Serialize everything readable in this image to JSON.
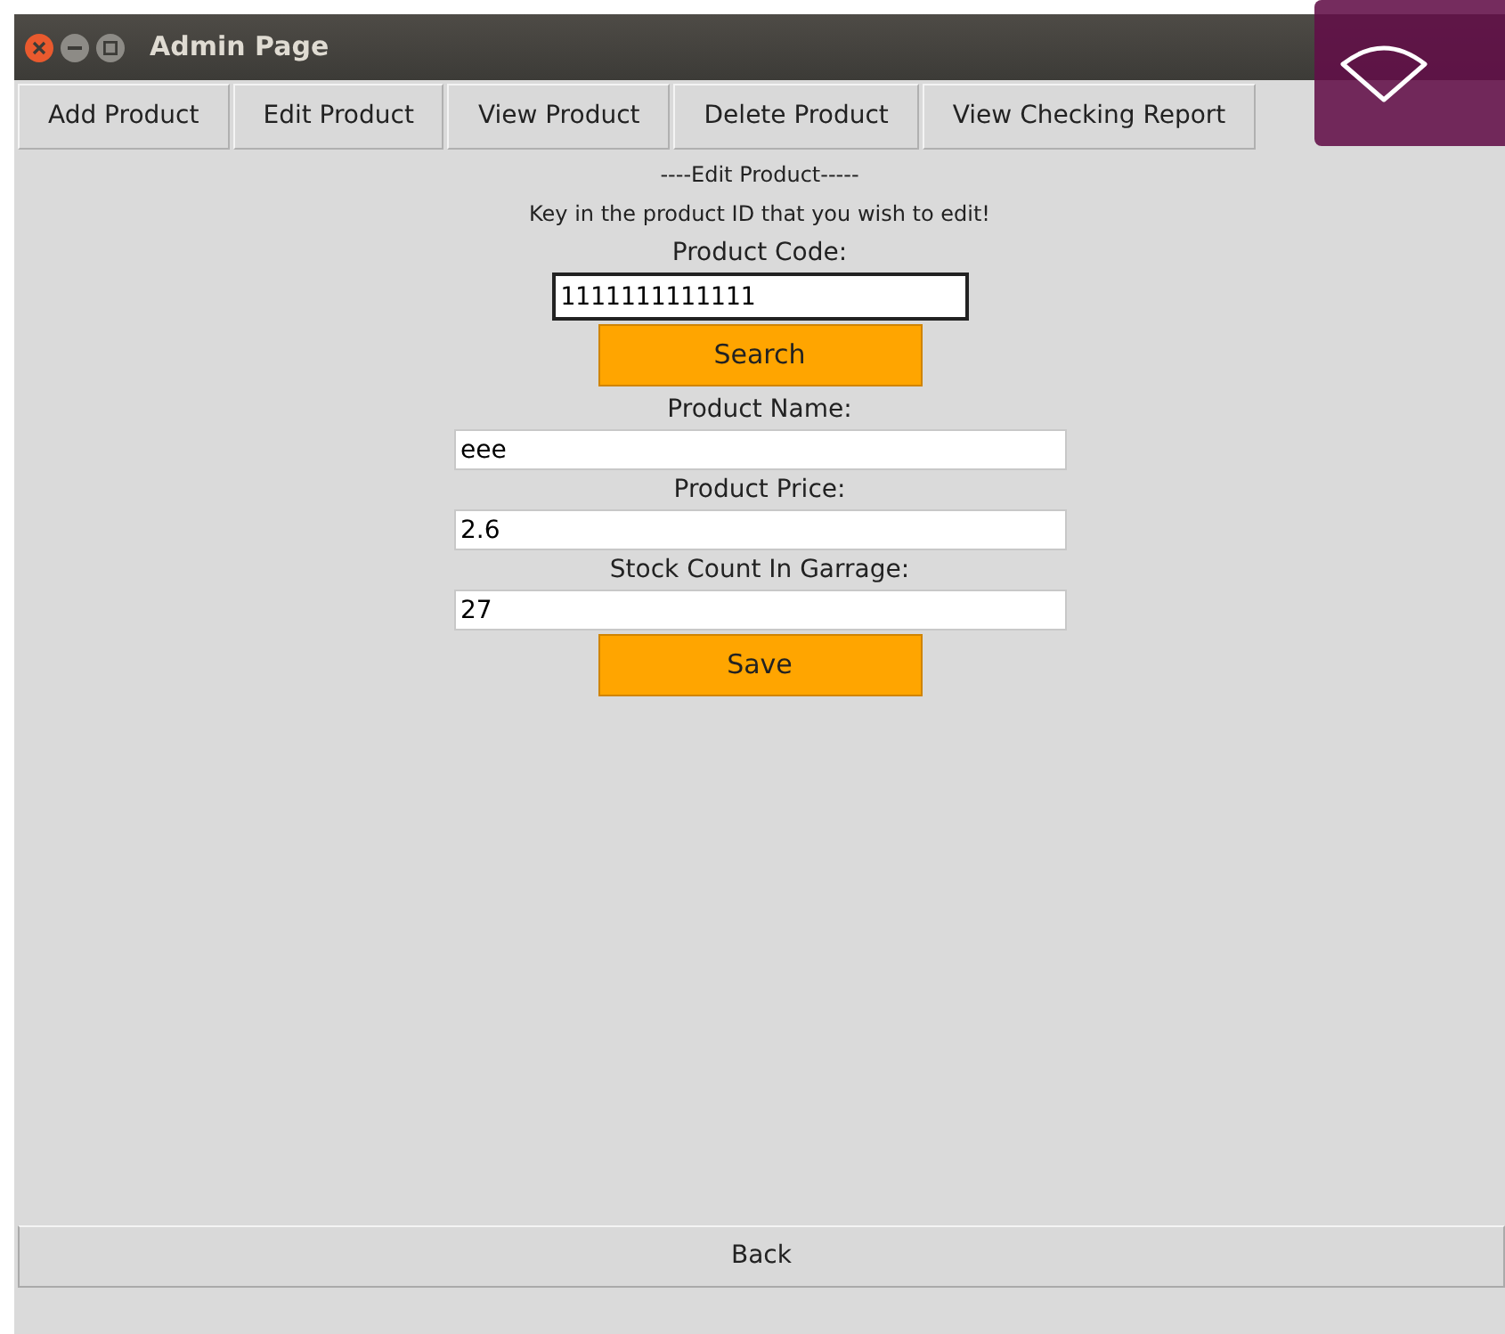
{
  "window": {
    "title": "Admin Page"
  },
  "tabs": [
    {
      "label": "Add Product"
    },
    {
      "label": "Edit Product"
    },
    {
      "label": "View Product"
    },
    {
      "label": "Delete Product"
    },
    {
      "label": "View Checking Report"
    }
  ],
  "form": {
    "heading": "----Edit Product-----",
    "instruction": "Key in the product ID that you wish to edit!",
    "fields": [
      {
        "kind": "code",
        "label": "Product Code:",
        "value": "1111111111111",
        "focused": true
      },
      {
        "kind": "button",
        "label": "Search"
      },
      {
        "kind": "text",
        "label": "Product Name:",
        "value": "eee",
        "focused": false
      },
      {
        "kind": "text",
        "label": "Product Price:",
        "value": "2.6",
        "focused": false
      },
      {
        "kind": "text",
        "label": "Stock Count In Garrage:",
        "value": "27",
        "focused": false
      },
      {
        "kind": "button",
        "label": "Save"
      }
    ]
  },
  "back_button": {
    "label": "Back"
  },
  "notification": {
    "kind": "network"
  }
}
